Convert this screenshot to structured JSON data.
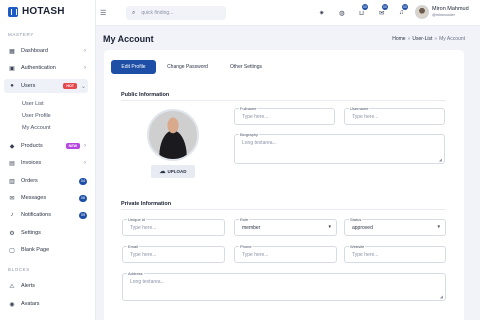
{
  "app": {
    "logo_text": "HOTASH"
  },
  "sidebar": {
    "section_mastery": "MASTERY",
    "section_blocks": "BLOCKS",
    "items": [
      {
        "label": "Dashboard"
      },
      {
        "label": "Authentication"
      },
      {
        "label": "Users",
        "badge": "HOT"
      },
      {
        "label": "Products",
        "badge": "NEW"
      },
      {
        "label": "Invoices"
      },
      {
        "label": "Orders",
        "count": "04"
      },
      {
        "label": "Messages",
        "count": "06"
      },
      {
        "label": "Notifications",
        "count": "09"
      },
      {
        "label": "Settings"
      },
      {
        "label": "Blank Page"
      }
    ],
    "sub_items": [
      "User List",
      "User Profile",
      "My Account"
    ],
    "block_items": [
      {
        "label": "Alerts"
      },
      {
        "label": "Avatars"
      }
    ]
  },
  "topbar": {
    "search_placeholder": "quick finding...",
    "cart_count": "00",
    "mail_count": "00",
    "bell_count": "00",
    "user_name": "Miron Mahmud",
    "user_handle": "@mironcoder"
  },
  "page": {
    "title": "My Account",
    "breadcrumb": [
      "Home",
      "User-List",
      "My Account"
    ]
  },
  "tabs": [
    "Edit Profile",
    "Change Password",
    "Other Settings"
  ],
  "public_info": {
    "title": "Public Information",
    "upload_label": "UPLOAD",
    "fullname": {
      "label": "Fullname",
      "placeholder": "Type here..."
    },
    "username": {
      "label": "Username",
      "placeholder": "Type here..."
    },
    "biography": {
      "label": "Biography",
      "placeholder": "Long textarea..."
    }
  },
  "private_info": {
    "title": "Private Information",
    "unique_id": {
      "label": "Unique id",
      "placeholder": "Type here..."
    },
    "role": {
      "label": "Role",
      "value": "member"
    },
    "status": {
      "label": "Status",
      "value": "approved"
    },
    "email": {
      "label": "Email",
      "placeholder": "Type here..."
    },
    "phone": {
      "label": "Phone",
      "placeholder": "Type here..."
    },
    "website": {
      "label": "Website",
      "placeholder": "Type here..."
    },
    "address": {
      "label": "Address",
      "placeholder": "Long textarea..."
    }
  },
  "icons": {
    "hamburger": "menu-icon",
    "search": "search-icon",
    "theme": "sun-icon",
    "language": "globe-icon",
    "cart": "cart-icon",
    "mail": "mail-icon",
    "bell": "bell-icon",
    "upload": "cloud-upload-icon"
  },
  "colors": {
    "accent": "#1e4fa6",
    "hot_badge": "#e5484d",
    "new_badge": "#b547e0"
  }
}
